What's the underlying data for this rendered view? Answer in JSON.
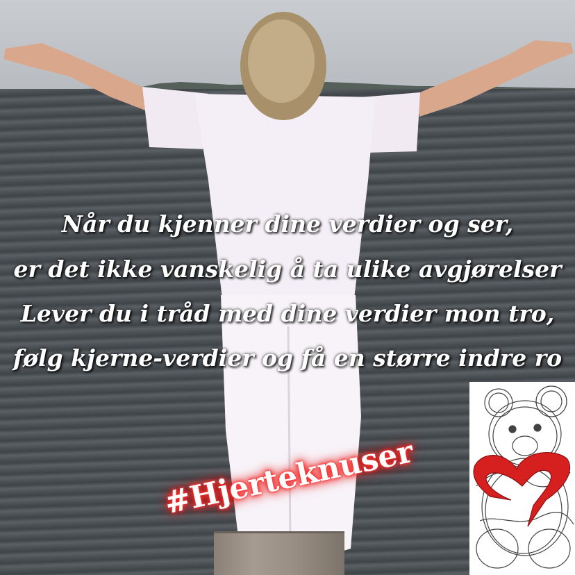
{
  "poem": {
    "line1": "Når du kjenner dine verdier og ser,",
    "line2": "er det ikke vanskelig å ta ulike avgjørelser",
    "line3": "Lever du i tråd med dine verdier mon tro,",
    "line4": "følg kjerne-verdier og få en større indre ro"
  },
  "hashtag": "#Hjerteknuser",
  "logo": {
    "icon": "teddy-bear-with-red-heart",
    "heart_color": "#d62020"
  },
  "colors": {
    "text": "#ffffff",
    "glow": "#ff1a1a"
  }
}
